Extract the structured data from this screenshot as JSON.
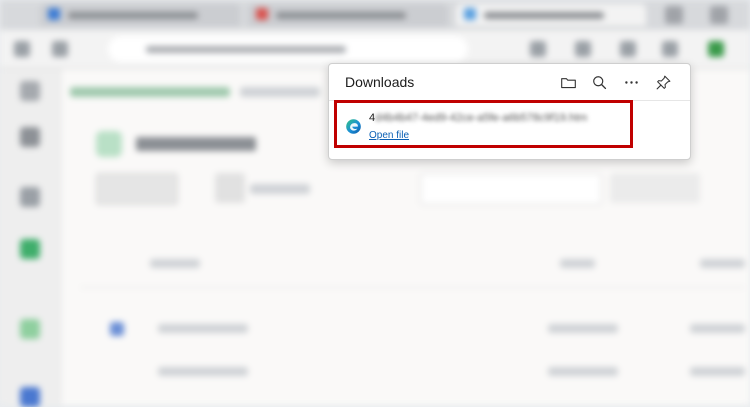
{
  "downloads": {
    "title": "Downloads",
    "header_icons": [
      "folder-icon",
      "search-icon",
      "more-icon",
      "pin-icon"
    ],
    "item": {
      "app_icon": "edge-icon",
      "filename_visible": "4",
      "filename_obscured": "d4b4b47-4ed9-42ce-a5fe-a6b578c9f19.htm",
      "action_label": "Open file"
    }
  },
  "colors": {
    "highlight": "#c00000",
    "link": "#0a5fb4"
  }
}
